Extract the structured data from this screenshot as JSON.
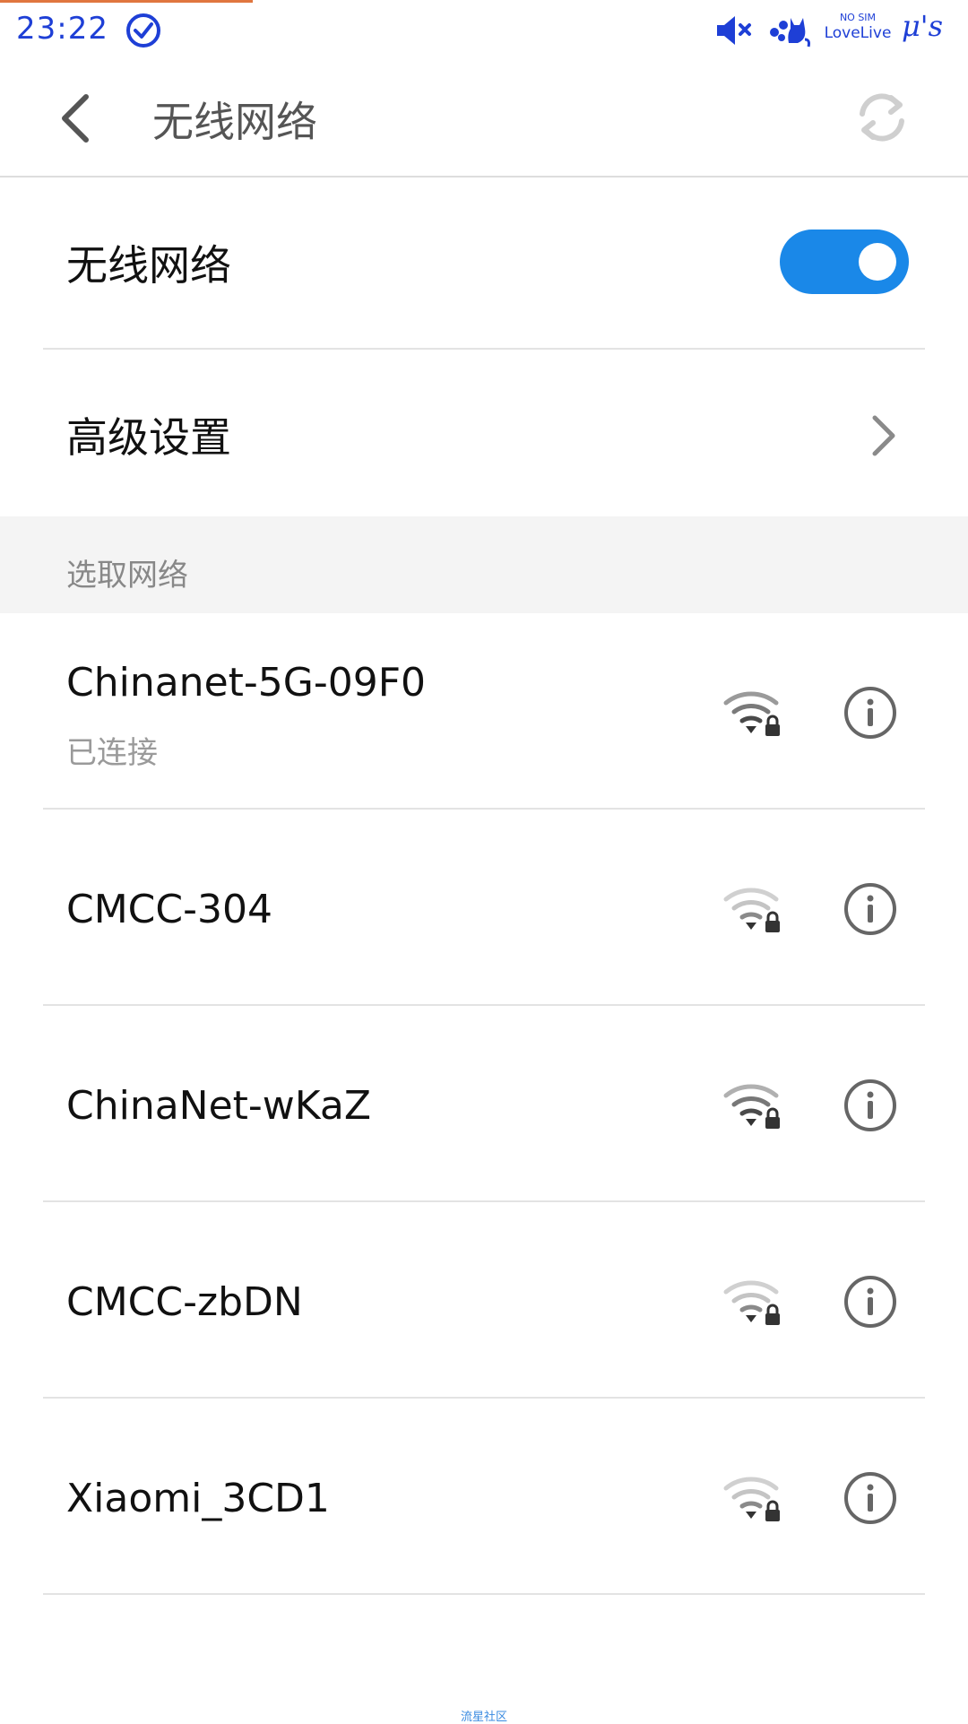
{
  "status_bar": {
    "time": "23:22",
    "sim_top": "NO SIM",
    "sim_bottom": "LoveLive",
    "brand": "μ's",
    "accent_color": "#e0763f",
    "icon_color": "#1e3fd6",
    "icons": [
      "check-circle-icon",
      "volume-mute-icon",
      "cat-sticker-icon"
    ]
  },
  "header": {
    "title": "无线网络",
    "back_icon": "chevron-left-icon",
    "refresh_icon": "refresh-icon"
  },
  "settings": {
    "wifi_label": "无线网络",
    "wifi_enabled": true,
    "toggle_color": "#1a88e8",
    "advanced_label": "高级设置"
  },
  "section": {
    "title": "选取网络"
  },
  "networks": [
    {
      "name": "Chinanet-5G-09F0",
      "status": "已连接",
      "signal_level": 4,
      "secured": true
    },
    {
      "name": "CMCC-304",
      "status": "",
      "signal_level": 2,
      "secured": true
    },
    {
      "name": "ChinaNet-wKaZ",
      "status": "",
      "signal_level": 3,
      "secured": true
    },
    {
      "name": "CMCC-zbDN",
      "status": "",
      "signal_level": 2,
      "secured": true
    },
    {
      "name": "Xiaomi_3CD1",
      "status": "",
      "signal_level": 2,
      "secured": true
    }
  ],
  "watermark": "流星社区"
}
